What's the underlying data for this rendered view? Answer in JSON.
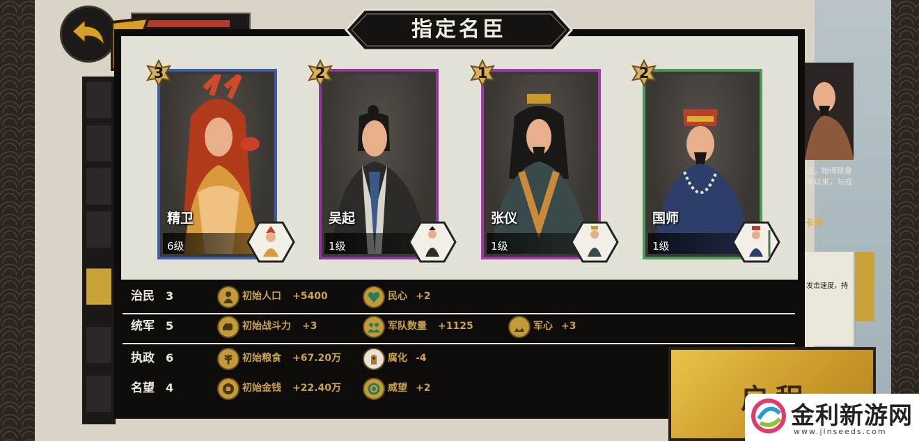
{
  "title": "指定名臣",
  "ministers": [
    {
      "name": "精卫",
      "level": "6级",
      "rank": "3",
      "frame_color": "#3b5ea8",
      "hair": "#b33a1a"
    },
    {
      "name": "吴起",
      "level": "1级",
      "rank": "2",
      "frame_color": "#8a3a9a",
      "hair": "#1a1816"
    },
    {
      "name": "张仪",
      "level": "1级",
      "rank": "1",
      "frame_color": "#a03aa8",
      "hair": "#1a1816"
    },
    {
      "name": "国师",
      "level": "1级",
      "rank": "2",
      "frame_color": "#4a9a5a",
      "hair": "#1a1816"
    }
  ],
  "stats": [
    {
      "category": "治民",
      "value": "3",
      "effects": [
        {
          "icon": "population-icon",
          "label": "初始人口",
          "value": "+5400"
        },
        {
          "icon": "heart-icon",
          "label": "民心",
          "value": "+2"
        }
      ]
    },
    {
      "category": "统军",
      "value": "5",
      "effects": [
        {
          "icon": "fist-icon",
          "label": "初始战斗力",
          "value": "+3"
        },
        {
          "icon": "army-icon",
          "label": "军队数量",
          "value": "+1125"
        },
        {
          "icon": "morale-icon",
          "label": "军心",
          "value": "+3"
        }
      ]
    },
    {
      "category": "执政",
      "value": "6",
      "effects": [
        {
          "icon": "grain-icon",
          "label": "初始粮食",
          "value": "+67.20万"
        },
        {
          "icon": "corruption-icon",
          "label": "腐化",
          "value": "-4"
        }
      ]
    },
    {
      "category": "名望",
      "value": "4",
      "effects": [
        {
          "icon": "coin-icon",
          "label": "初始金钱",
          "value": "+22.40万"
        },
        {
          "icon": "prestige-icon",
          "label": "威望",
          "value": "+2"
        }
      ]
    }
  ],
  "depart_button": "启程",
  "side_panel": {
    "text_line1": "迁，始得跻身",
    "text_line2": "年以来，与戎",
    "cards_label": "卡牌",
    "paper_text": "发击速度，持"
  },
  "watermark": {
    "title": "金利新游网",
    "url": "www.jlnseeds.com"
  },
  "colors": {
    "gold": "#caa34a",
    "modal_bg": "#0d0c0b",
    "cream": "#e4e1d7"
  }
}
